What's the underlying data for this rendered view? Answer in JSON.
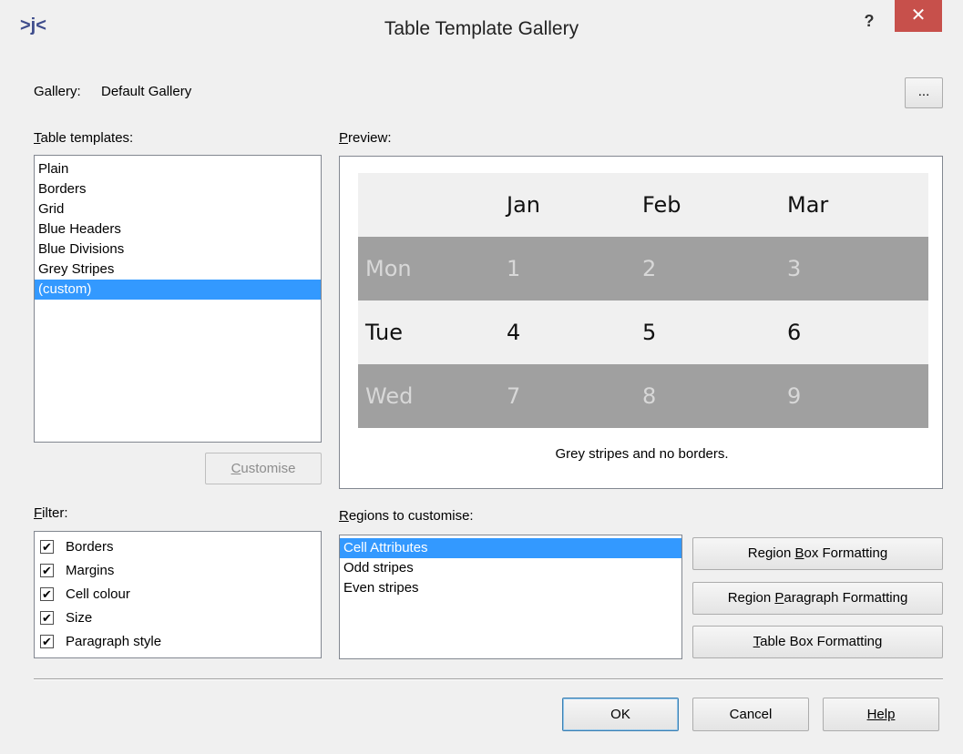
{
  "window": {
    "title": "Table Template Gallery",
    "help_label": "?",
    "close_label": "✕",
    "app_icon": ">j<"
  },
  "gallery": {
    "label": "Gallery:",
    "value": "Default Gallery",
    "browse_label": "..."
  },
  "templates": {
    "label": "Table templates:",
    "items": [
      "Plain",
      "Borders",
      "Grid",
      "Blue Headers",
      "Blue Divisions",
      "Grey Stripes",
      "(custom)"
    ],
    "selected_index": 6,
    "customise_label": "Customise"
  },
  "preview": {
    "label": "Preview:",
    "header": [
      "",
      "Jan",
      "Feb",
      "Mar"
    ],
    "rows": [
      [
        "Mon",
        "1",
        "2",
        "3"
      ],
      [
        "Tue",
        "4",
        "5",
        "6"
      ],
      [
        "Wed",
        "7",
        "8",
        "9"
      ]
    ],
    "caption": "Grey stripes and no borders.",
    "colors": {
      "stripe": "#a0a0a0",
      "light": "#f0f0f0"
    }
  },
  "filter": {
    "label": "Filter:",
    "items": [
      {
        "label": "Borders",
        "checked": true
      },
      {
        "label": "Margins",
        "checked": true
      },
      {
        "label": "Cell colour",
        "checked": true
      },
      {
        "label": "Size",
        "checked": true
      },
      {
        "label": "Paragraph style",
        "checked": true
      }
    ]
  },
  "regions": {
    "label": "Regions to customise:",
    "items": [
      "Cell Attributes",
      "Odd stripes",
      "Even stripes"
    ],
    "selected_index": 0
  },
  "formatting_buttons": {
    "region_box": "Region Box Formatting",
    "region_paragraph": "Region Paragraph Formatting",
    "table_box": "Table Box Formatting"
  },
  "footer": {
    "ok": "OK",
    "cancel": "Cancel",
    "help": "Help"
  },
  "colors": {
    "selection": "#3399ff",
    "close_button": "#c7504b"
  }
}
